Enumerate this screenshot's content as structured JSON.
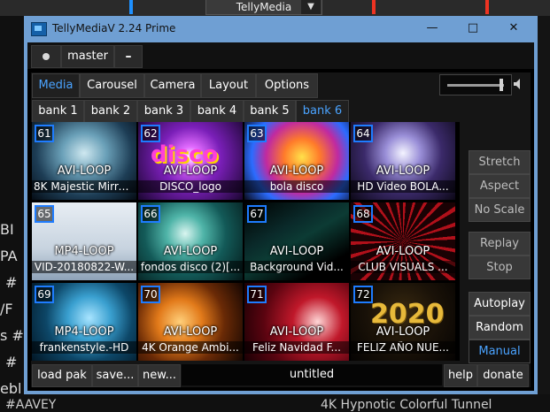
{
  "background": {
    "tab_label": "TellyMedia",
    "left_fragments": [
      "BI",
      "PA",
      "#",
      "/F",
      "s #",
      "#",
      "ebl"
    ],
    "bottom_left": "#AAVEY",
    "bottom_right": "4K Hypnotic Colorful Tunnel"
  },
  "window": {
    "title": "TellyMediaV 2.24 Prime",
    "minimize": "—",
    "maximize": "□",
    "close": "✕"
  },
  "master": {
    "label": "master",
    "minus": "–"
  },
  "nav_tabs": [
    {
      "label": "Media",
      "active": true
    },
    {
      "label": "Carousel",
      "active": false
    },
    {
      "label": "Camera",
      "active": false
    },
    {
      "label": "Layout",
      "active": false
    },
    {
      "label": "Options",
      "active": false
    }
  ],
  "volume_level": 0.95,
  "bank_tabs": [
    {
      "label": "bank 1",
      "active": false
    },
    {
      "label": "bank 2",
      "active": false
    },
    {
      "label": "bank 3",
      "active": false
    },
    {
      "label": "bank 4",
      "active": false
    },
    {
      "label": "bank 5",
      "active": false
    },
    {
      "label": "bank 6",
      "active": true
    }
  ],
  "cells": [
    {
      "num": "61",
      "type": "AVI-LOOP",
      "name": "8K Majestic Mirro...",
      "thumb": "thumb-aurora"
    },
    {
      "num": "62",
      "type": "AVI-LOOP",
      "name": "DISCO_logo",
      "thumb": "thumb-disco"
    },
    {
      "num": "63",
      "type": "AVI-LOOP",
      "name": "bola disco",
      "thumb": "thumb-discoball"
    },
    {
      "num": "64",
      "type": "AVI-LOOP",
      "name": "HD Video BOLA...",
      "thumb": "thumb-mirrorball"
    },
    {
      "num": "65",
      "type": "MP4-LOOP",
      "name": "VID-20180822-W...",
      "thumb": "thumb-invite"
    },
    {
      "num": "66",
      "type": "AVI-LOOP",
      "name": "fondos disco (2)[...",
      "thumb": "thumb-teal"
    },
    {
      "num": "67",
      "type": "AVI-LOOP",
      "name": "Background Vid...",
      "thumb": "thumb-beams"
    },
    {
      "num": "68",
      "type": "AVI-LOOP",
      "name": "CLUB VISUALS ...",
      "thumb": "thumb-redrays"
    },
    {
      "num": "69",
      "type": "MP4-LOOP",
      "name": "frankenstyle.-HD",
      "thumb": "thumb-bubbles"
    },
    {
      "num": "70",
      "type": "AVI-LOOP",
      "name": "4K Orange Ambi...",
      "thumb": "thumb-orange"
    },
    {
      "num": "71",
      "type": "AVI-LOOP",
      "name": "Feliz Navidad F...",
      "thumb": "thumb-xmas"
    },
    {
      "num": "72",
      "type": "AVI-LOOP",
      "name": "FELIZ AÑO NUE...",
      "thumb": "thumb-2020"
    }
  ],
  "side_buttons": {
    "stretch": "Stretch",
    "aspect": "Aspect",
    "no_scale": "No Scale",
    "replay": "Replay",
    "stop": "Stop",
    "autoplay": "Autoplay",
    "random": "Random",
    "manual": "Manual"
  },
  "bottom": {
    "load_pak": "load pak",
    "save": "save...",
    "new": "new...",
    "filename": "untitled",
    "help": "help",
    "donate": "donate"
  },
  "colors": {
    "accent": "#4aa3ff",
    "title_bar": "#6f9fd3",
    "number_border": "#1e7cff"
  }
}
